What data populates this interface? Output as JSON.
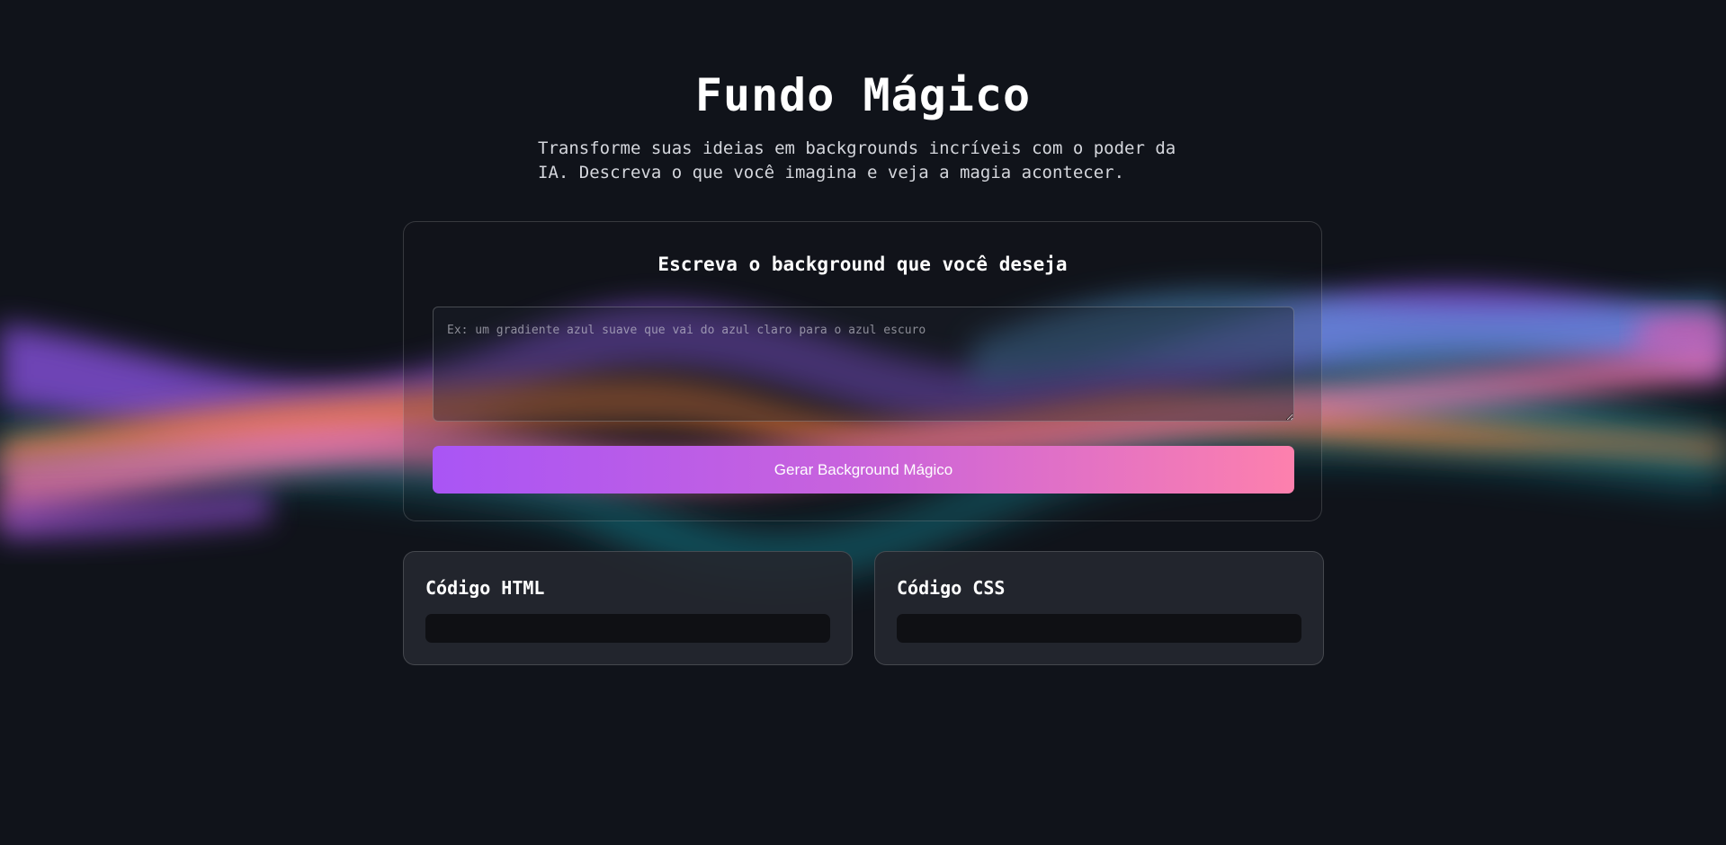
{
  "header": {
    "title": "Fundo Mágico",
    "subtitle": "Transforme suas ideias em backgrounds incríveis com o poder da IA. Descreva o que você imagina e veja a magia acontecer."
  },
  "form": {
    "heading": "Escreva o background que você deseja",
    "prompt_value": "",
    "prompt_placeholder": "Ex: um gradiente azul suave que vai do azul claro para o azul escuro",
    "button_label": "Gerar Background Mágico"
  },
  "output": {
    "html_title": "Código HTML",
    "html_code": "",
    "css_title": "Código CSS",
    "css_code": ""
  },
  "colors": {
    "background": "#10131a",
    "button_gradient_start": "#a955f5",
    "button_gradient_end": "#fd80ad",
    "wave_purple": "#9b5cf0",
    "wave_pink": "#ff7eb6",
    "wave_orange": "#ef7a35",
    "wave_teal": "#16a7b9",
    "wave_blue": "#6e8be8"
  },
  "decoration": {
    "background_art": "blurred-rainbow-wave"
  }
}
